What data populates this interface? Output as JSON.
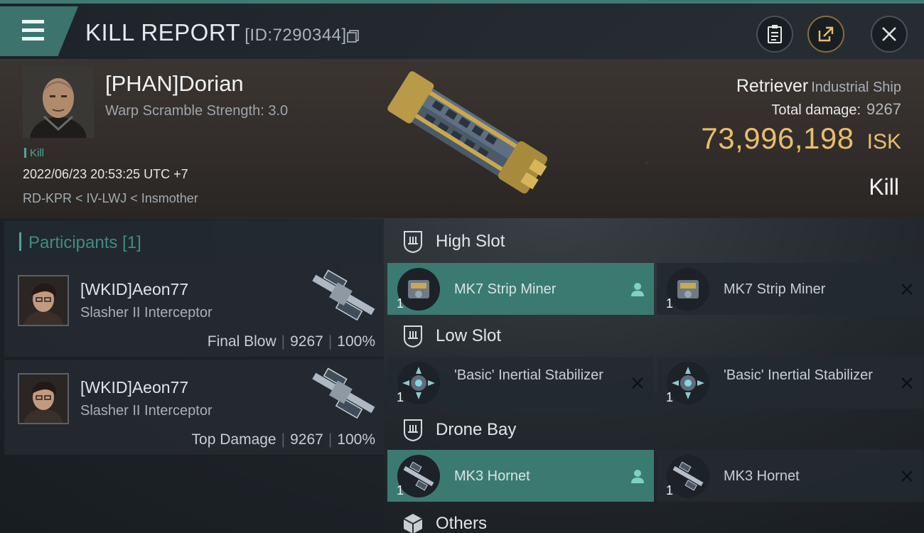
{
  "header": {
    "title": "KILL REPORT",
    "kill_id": "[ID:7290344]",
    "icons": [
      "menu-icon",
      "copy-icon",
      "clipboard-icon",
      "share-icon",
      "close-icon"
    ]
  },
  "victim": {
    "name": "[PHAN]Dorian",
    "warp_scramble": "Warp Scramble Strength: 3.0",
    "tag": "Kill",
    "datetime": "2022/06/23 20:53:25 UTC +7",
    "location": "RD-KPR < IV-LWJ < Insmother",
    "ship_name": "Retriever",
    "ship_class": "Industrial Ship",
    "total_damage_label": "Total damage:",
    "total_damage": "9267",
    "isk_value": "73,996,198",
    "isk_unit": "ISK",
    "result": "Kill"
  },
  "participants": {
    "title": "Participants [1]",
    "rows": [
      {
        "name": "[WKID]Aeon77",
        "ship": "Slasher II Interceptor",
        "role": "Final Blow",
        "damage": "9267",
        "percent": "100%"
      },
      {
        "name": "[WKID]Aeon77",
        "ship": "Slasher II Interceptor",
        "role": "Top Damage",
        "damage": "9267",
        "percent": "100%"
      }
    ]
  },
  "fitting": {
    "high_slot": {
      "label": "High Slot",
      "modules": [
        {
          "name": "MK7 Strip Miner",
          "qty": "1",
          "state": "person-icon",
          "active": true
        },
        {
          "name": "MK7 Strip Miner",
          "qty": "1",
          "state": "x-icon",
          "active": false
        }
      ]
    },
    "low_slot": {
      "label": "Low Slot",
      "modules": [
        {
          "name": "'Basic' Inertial Stabilizer",
          "qty": "1",
          "state": "x-icon",
          "active": false
        },
        {
          "name": "'Basic' Inertial Stabilizer",
          "qty": "1",
          "state": "x-icon",
          "active": false
        }
      ]
    },
    "drone_bay": {
      "label": "Drone Bay",
      "modules": [
        {
          "name": "MK3  Hornet",
          "qty": "1",
          "state": "person-icon",
          "active": true
        },
        {
          "name": "MK3  Hornet",
          "qty": "1",
          "state": "x-icon",
          "active": false
        }
      ]
    },
    "others": {
      "label": "Others"
    }
  },
  "colors": {
    "accent": "#3b7a71",
    "isk": "#e9bd6e",
    "teal_text": "#4aa79a"
  }
}
